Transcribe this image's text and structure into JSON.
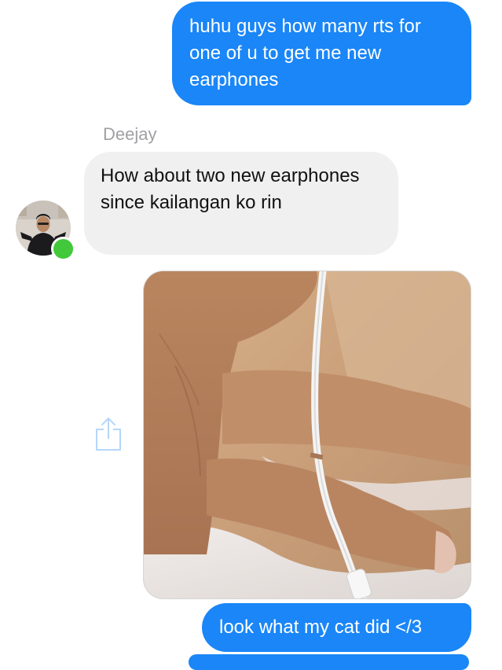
{
  "conversation": {
    "messages": [
      {
        "direction": "outgoing",
        "text": "huhu guys how many rts for one of u to get me new earphones"
      },
      {
        "direction": "incoming",
        "sender": "Deejay",
        "text": "How about two new earphones since kailangan ko rin"
      },
      {
        "direction": "outgoing",
        "type": "image",
        "share_icon": "share-icon"
      },
      {
        "direction": "outgoing",
        "text": "look what my cat did </3"
      }
    ]
  },
  "colors": {
    "outgoing_bubble": "#1a86f7",
    "incoming_bubble": "#f1f0f0",
    "presence_online": "#42c83b",
    "sender_name": "#a0a0a5"
  }
}
